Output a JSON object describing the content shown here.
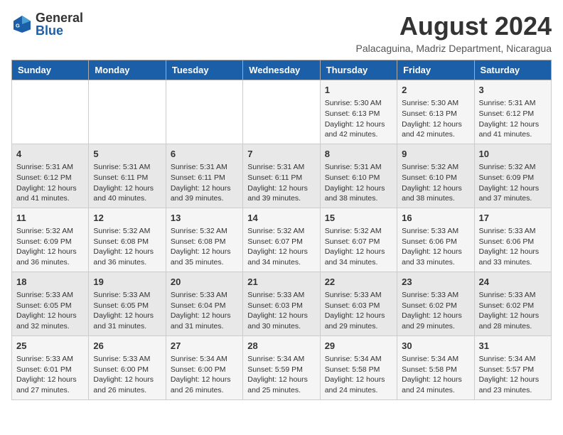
{
  "header": {
    "logo_general": "General",
    "logo_blue": "Blue",
    "month_year": "August 2024",
    "location": "Palacaguina, Madriz Department, Nicaragua"
  },
  "days_of_week": [
    "Sunday",
    "Monday",
    "Tuesday",
    "Wednesday",
    "Thursday",
    "Friday",
    "Saturday"
  ],
  "weeks": [
    [
      {
        "day": "",
        "content": ""
      },
      {
        "day": "",
        "content": ""
      },
      {
        "day": "",
        "content": ""
      },
      {
        "day": "",
        "content": ""
      },
      {
        "day": "1",
        "content": "Sunrise: 5:30 AM\nSunset: 6:13 PM\nDaylight: 12 hours\nand 42 minutes."
      },
      {
        "day": "2",
        "content": "Sunrise: 5:30 AM\nSunset: 6:13 PM\nDaylight: 12 hours\nand 42 minutes."
      },
      {
        "day": "3",
        "content": "Sunrise: 5:31 AM\nSunset: 6:12 PM\nDaylight: 12 hours\nand 41 minutes."
      }
    ],
    [
      {
        "day": "4",
        "content": "Sunrise: 5:31 AM\nSunset: 6:12 PM\nDaylight: 12 hours\nand 41 minutes."
      },
      {
        "day": "5",
        "content": "Sunrise: 5:31 AM\nSunset: 6:11 PM\nDaylight: 12 hours\nand 40 minutes."
      },
      {
        "day": "6",
        "content": "Sunrise: 5:31 AM\nSunset: 6:11 PM\nDaylight: 12 hours\nand 39 minutes."
      },
      {
        "day": "7",
        "content": "Sunrise: 5:31 AM\nSunset: 6:11 PM\nDaylight: 12 hours\nand 39 minutes."
      },
      {
        "day": "8",
        "content": "Sunrise: 5:31 AM\nSunset: 6:10 PM\nDaylight: 12 hours\nand 38 minutes."
      },
      {
        "day": "9",
        "content": "Sunrise: 5:32 AM\nSunset: 6:10 PM\nDaylight: 12 hours\nand 38 minutes."
      },
      {
        "day": "10",
        "content": "Sunrise: 5:32 AM\nSunset: 6:09 PM\nDaylight: 12 hours\nand 37 minutes."
      }
    ],
    [
      {
        "day": "11",
        "content": "Sunrise: 5:32 AM\nSunset: 6:09 PM\nDaylight: 12 hours\nand 36 minutes."
      },
      {
        "day": "12",
        "content": "Sunrise: 5:32 AM\nSunset: 6:08 PM\nDaylight: 12 hours\nand 36 minutes."
      },
      {
        "day": "13",
        "content": "Sunrise: 5:32 AM\nSunset: 6:08 PM\nDaylight: 12 hours\nand 35 minutes."
      },
      {
        "day": "14",
        "content": "Sunrise: 5:32 AM\nSunset: 6:07 PM\nDaylight: 12 hours\nand 34 minutes."
      },
      {
        "day": "15",
        "content": "Sunrise: 5:32 AM\nSunset: 6:07 PM\nDaylight: 12 hours\nand 34 minutes."
      },
      {
        "day": "16",
        "content": "Sunrise: 5:33 AM\nSunset: 6:06 PM\nDaylight: 12 hours\nand 33 minutes."
      },
      {
        "day": "17",
        "content": "Sunrise: 5:33 AM\nSunset: 6:06 PM\nDaylight: 12 hours\nand 33 minutes."
      }
    ],
    [
      {
        "day": "18",
        "content": "Sunrise: 5:33 AM\nSunset: 6:05 PM\nDaylight: 12 hours\nand 32 minutes."
      },
      {
        "day": "19",
        "content": "Sunrise: 5:33 AM\nSunset: 6:05 PM\nDaylight: 12 hours\nand 31 minutes."
      },
      {
        "day": "20",
        "content": "Sunrise: 5:33 AM\nSunset: 6:04 PM\nDaylight: 12 hours\nand 31 minutes."
      },
      {
        "day": "21",
        "content": "Sunrise: 5:33 AM\nSunset: 6:03 PM\nDaylight: 12 hours\nand 30 minutes."
      },
      {
        "day": "22",
        "content": "Sunrise: 5:33 AM\nSunset: 6:03 PM\nDaylight: 12 hours\nand 29 minutes."
      },
      {
        "day": "23",
        "content": "Sunrise: 5:33 AM\nSunset: 6:02 PM\nDaylight: 12 hours\nand 29 minutes."
      },
      {
        "day": "24",
        "content": "Sunrise: 5:33 AM\nSunset: 6:02 PM\nDaylight: 12 hours\nand 28 minutes."
      }
    ],
    [
      {
        "day": "25",
        "content": "Sunrise: 5:33 AM\nSunset: 6:01 PM\nDaylight: 12 hours\nand 27 minutes."
      },
      {
        "day": "26",
        "content": "Sunrise: 5:33 AM\nSunset: 6:00 PM\nDaylight: 12 hours\nand 26 minutes."
      },
      {
        "day": "27",
        "content": "Sunrise: 5:34 AM\nSunset: 6:00 PM\nDaylight: 12 hours\nand 26 minutes."
      },
      {
        "day": "28",
        "content": "Sunrise: 5:34 AM\nSunset: 5:59 PM\nDaylight: 12 hours\nand 25 minutes."
      },
      {
        "day": "29",
        "content": "Sunrise: 5:34 AM\nSunset: 5:58 PM\nDaylight: 12 hours\nand 24 minutes."
      },
      {
        "day": "30",
        "content": "Sunrise: 5:34 AM\nSunset: 5:58 PM\nDaylight: 12 hours\nand 24 minutes."
      },
      {
        "day": "31",
        "content": "Sunrise: 5:34 AM\nSunset: 5:57 PM\nDaylight: 12 hours\nand 23 minutes."
      }
    ]
  ]
}
